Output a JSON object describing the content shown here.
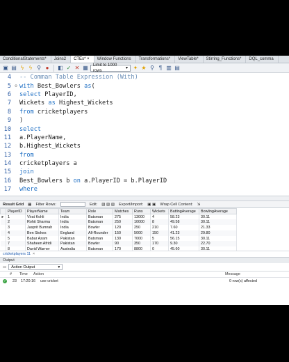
{
  "tabs": [
    "ConditionalStatements*",
    "Joins2",
    "CTEs*",
    "Window Functions",
    "Transformations*",
    "ViewTable*",
    "Stirring_Functions*",
    "DQL_comma"
  ],
  "active_tab": 2,
  "toolbar": {
    "icons": [
      "folder-icon",
      "save-icon",
      "bolt-icon",
      "bolt-cursor-icon",
      "search-icon",
      "stop-icon",
      "toggle-icon",
      "check-icon",
      "cancel-icon",
      "autocommit-icon"
    ],
    "limit_label": "Limit to 1000 rows",
    "right_icons": [
      "beautify-icon",
      "star-icon",
      "search-icon",
      "comment-icon",
      "wrap-icon",
      "table-icon"
    ]
  },
  "editor": {
    "lines": [
      {
        "n": "4",
        "fold": "",
        "parts": [
          {
            "t": "-- Comman Table Expression (With)",
            "c": "cm"
          }
        ]
      },
      {
        "n": "5",
        "fold": "⊖",
        "parts": [
          {
            "t": "with ",
            "c": "kw"
          },
          {
            "t": "Best_Bowlers ",
            "c": ""
          },
          {
            "t": "as",
            "c": "kw"
          },
          {
            "t": "(",
            "c": ""
          }
        ]
      },
      {
        "n": "6",
        "fold": "",
        "parts": [
          {
            "t": "select ",
            "c": "kw"
          },
          {
            "t": "PlayerID,",
            "c": ""
          }
        ]
      },
      {
        "n": "7",
        "fold": "",
        "parts": [
          {
            "t": "Wickets ",
            "c": ""
          },
          {
            "t": "as ",
            "c": "kw"
          },
          {
            "t": "Highest_Wickets",
            "c": ""
          }
        ]
      },
      {
        "n": "8",
        "fold": "",
        "parts": [
          {
            "t": "from ",
            "c": "kw"
          },
          {
            "t": "cricketplayers",
            "c": ""
          }
        ]
      },
      {
        "n": "9",
        "fold": "",
        "parts": [
          {
            "t": ")",
            "c": ""
          }
        ]
      },
      {
        "n": "10",
        "fold": "",
        "parts": [
          {
            "t": "select",
            "c": "kw"
          }
        ]
      },
      {
        "n": "11",
        "fold": "",
        "parts": [
          {
            "t": "a.PlayerName,",
            "c": ""
          }
        ]
      },
      {
        "n": "12",
        "fold": "",
        "parts": [
          {
            "t": "b.Highest_Wickets",
            "c": ""
          }
        ]
      },
      {
        "n": "13",
        "fold": "",
        "parts": [
          {
            "t": "from",
            "c": "kw"
          }
        ]
      },
      {
        "n": "14",
        "fold": "",
        "parts": [
          {
            "t": "cricketplayers a",
            "c": ""
          }
        ]
      },
      {
        "n": "15",
        "fold": "",
        "parts": [
          {
            "t": "join",
            "c": "kw"
          }
        ]
      },
      {
        "n": "16",
        "fold": "",
        "parts": [
          {
            "t": "Best_Bowlers b ",
            "c": ""
          },
          {
            "t": "on ",
            "c": "kw"
          },
          {
            "t": "a.PlayerID = b.PlayerID",
            "c": ""
          }
        ]
      },
      {
        "n": "17",
        "fold": "",
        "parts": [
          {
            "t": "where",
            "c": "kw"
          }
        ]
      }
    ]
  },
  "result_bar": {
    "title": "Result Grid",
    "filter_label": "Filter Rows:",
    "edit_label": "Edit:",
    "export_label": "Export/Import:",
    "wrap_label": "Wrap Cell Content:"
  },
  "grid": {
    "columns": [
      "PlayerID",
      "PlayerName",
      "Team",
      "Role",
      "Matches",
      "Runs",
      "Wickets",
      "BattingAverage",
      "BowlingAverage"
    ],
    "rows": [
      [
        "1",
        "Virat Kohli",
        "India",
        "Batsman",
        "275",
        "13000",
        "4",
        "58.23",
        "30.11"
      ],
      [
        "2",
        "Rohit Sharma",
        "India",
        "Batsman",
        "250",
        "10000",
        "8",
        "49.58",
        "30.11"
      ],
      [
        "3",
        "Jasprit Bumrah",
        "India",
        "Bowler",
        "120",
        "250",
        "210",
        "7.60",
        "21.33"
      ],
      [
        "4",
        "Ben Stokes",
        "England",
        "All-Rounder",
        "150",
        "5000",
        "150",
        "41.23",
        "29.80"
      ],
      [
        "5",
        "Babar Azam",
        "Pakistan",
        "Batsman",
        "130",
        "7000",
        "5",
        "56.15",
        "30.11"
      ],
      [
        "7",
        "Shaheen Afridi",
        "Pakistan",
        "Bowler",
        "90",
        "350",
        "170",
        "9.30",
        "22.70"
      ],
      [
        "8",
        "David Warner",
        "Australia",
        "Batsman",
        "170",
        "8800",
        "0",
        "45.60",
        "30.11"
      ]
    ]
  },
  "result_tab": "cricketplayers 11",
  "output": {
    "header": "Output",
    "select_value": "Action Output",
    "columns": {
      "num": "#",
      "time": "Time",
      "action": "Action",
      "message": "Message"
    },
    "rows": [
      {
        "num": "23",
        "time": "17:20:16",
        "action": "use cricket",
        "message": "0 row(s) affected"
      }
    ]
  }
}
